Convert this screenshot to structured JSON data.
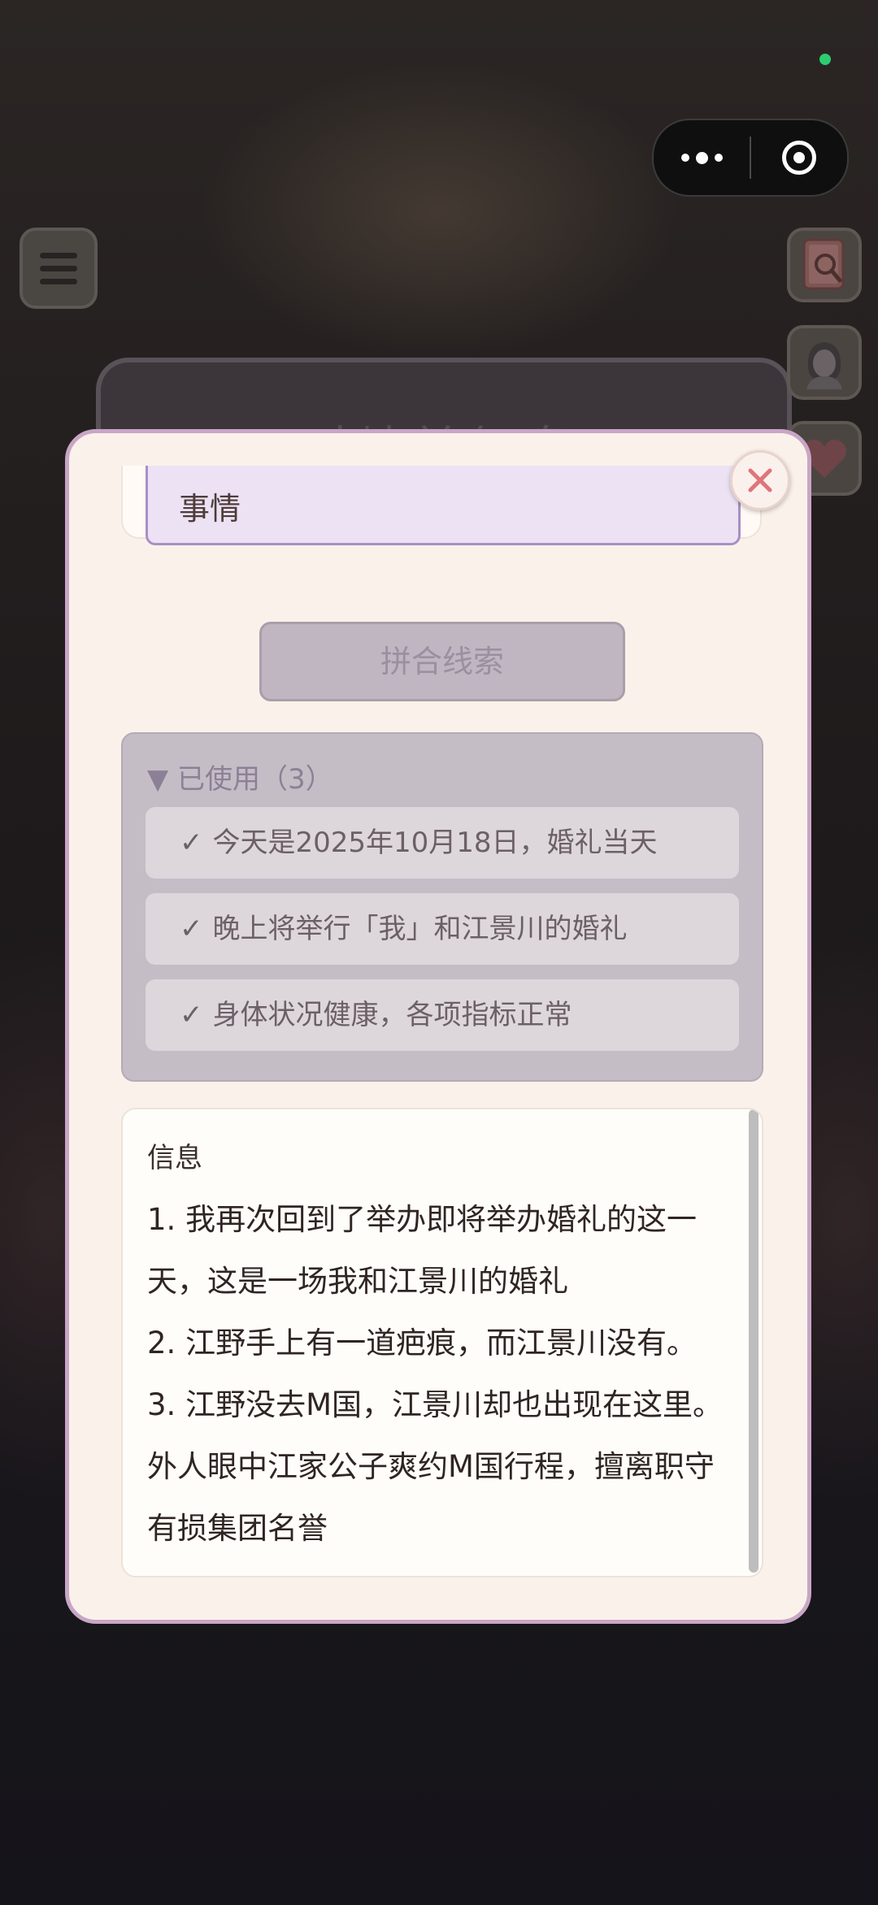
{
  "background": {
    "title": "对峙前复盘"
  },
  "capsule": {
    "more_icon": "more-dots-icon",
    "close_icon": "target-close-icon"
  },
  "side_buttons": [
    "notebook-search-icon",
    "character-portrait-icon",
    "heart-icon"
  ],
  "modal": {
    "top_input_value": "事情",
    "merge_button": "拼合线索",
    "used": {
      "header": "▼ 已使用（3）",
      "items": [
        "今天是2025年10月18日，婚礼当天",
        "晚上将举行「我」和江景川的婚礼",
        "身体状况健康，各项指标正常"
      ]
    },
    "info": {
      "title": "信息",
      "lines": [
        "1. 我再次回到了举办即将举办婚礼的这一天，这是一场我和江景川的婚礼",
        "2. 江野手上有一道疤痕，而江景川没有。",
        "3. 江野没去M国，江景川却也出现在这里。外人眼中江家公子爽约M国行程，擅离职守有损集团名誉"
      ]
    }
  },
  "colors": {
    "accent": "#a98fc6",
    "modal_bg": "#faf2ea",
    "close_x": "#e0747c"
  }
}
